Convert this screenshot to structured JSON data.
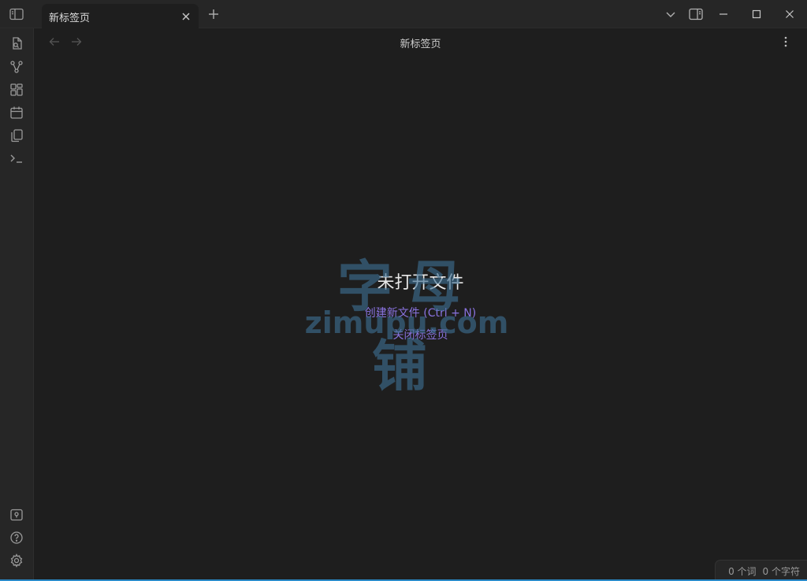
{
  "tab": {
    "title": "新标签页"
  },
  "view": {
    "title": "新标签页"
  },
  "empty_state": {
    "title": "未打开文件",
    "create_new": "创建新文件 (Ctrl + N)",
    "close_tab": "关闭标签页"
  },
  "watermark": {
    "line1": "字母铺",
    "line2": "zimupu.com"
  },
  "status_bar": {
    "words": "0 个词",
    "chars": "0 个字符"
  },
  "icons": {
    "titlebar": [
      "sidebar-toggle-icon",
      "close-icon",
      "plus-icon",
      "chevron-down-icon",
      "right-sidebar-icon",
      "minimize-icon",
      "maximize-icon",
      "window-close-icon"
    ],
    "ribbon_top": [
      "switcher-icon",
      "graph-icon",
      "canvas-icon",
      "calendar-icon",
      "templates-icon",
      "terminal-icon"
    ],
    "ribbon_bottom": [
      "vault-icon",
      "help-icon",
      "settings-icon"
    ],
    "view": [
      "back-arrow-icon",
      "forward-arrow-icon",
      "more-options-icon"
    ]
  },
  "colors": {
    "accent": "#8a73e0",
    "background": "#1e1e1e",
    "chrome": "#262626",
    "watermark": "#3e6f92"
  }
}
